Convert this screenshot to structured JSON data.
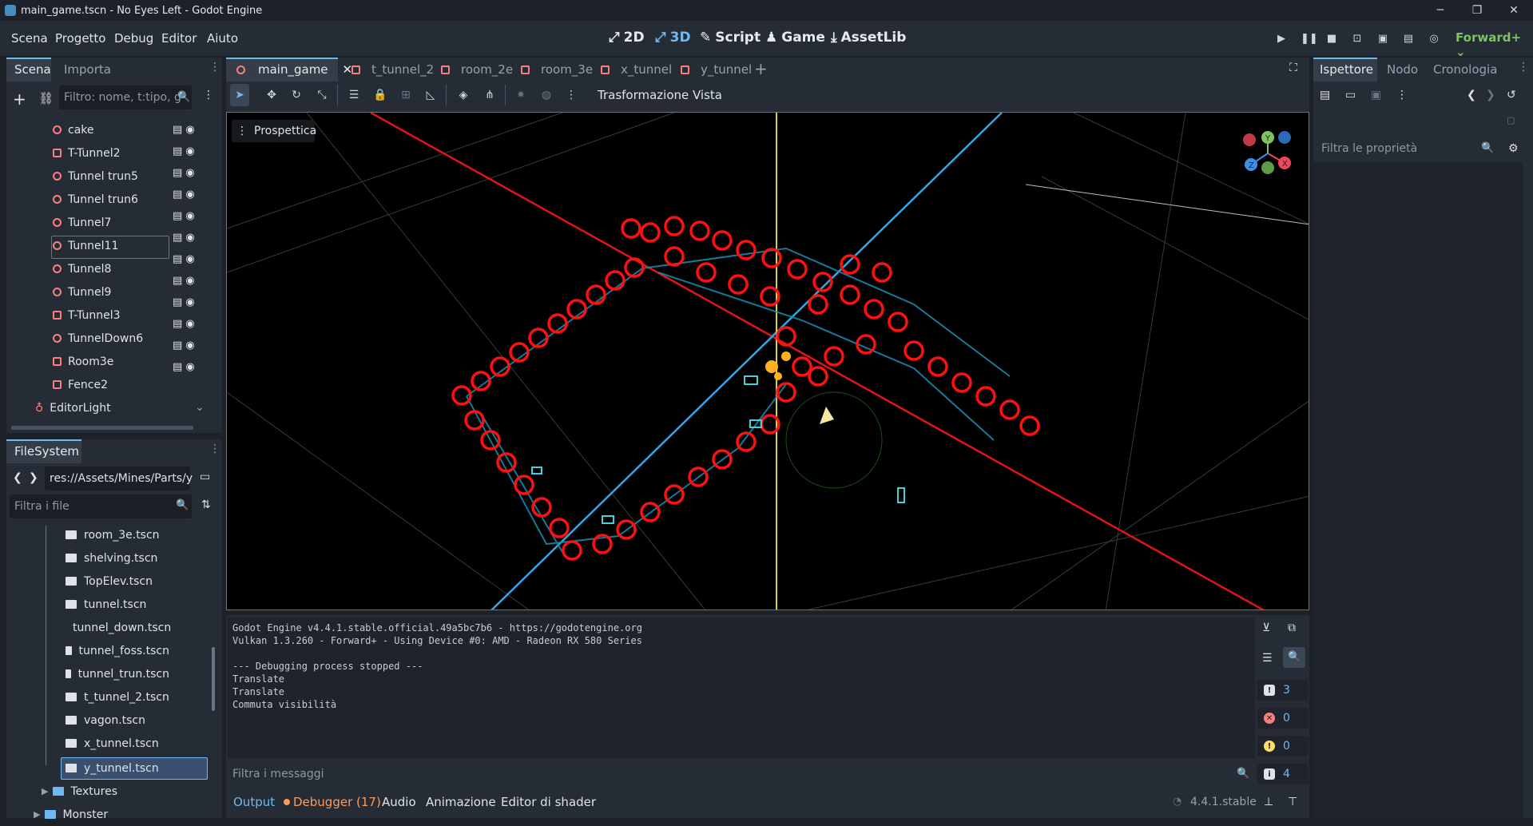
{
  "window": {
    "title": "main_game.tscn - No Eyes Left - Godot Engine"
  },
  "menu": [
    "Scena",
    "Progetto",
    "Debug",
    "Editor",
    "Aiuto"
  ],
  "modes": [
    "2D",
    "3D",
    "Script",
    "Game",
    "AssetLib"
  ],
  "renderer": "Forward+",
  "scene_dock": {
    "tabs": [
      "Scena",
      "Importa"
    ],
    "filter_placeholder": "Filtro: nome, t:tipo, g",
    "nodes": [
      "cake",
      "T-Tunnel2",
      "Tunnel trun5",
      "Tunnel trun6",
      "Tunnel7",
      "Tunnel11",
      "Tunnel8",
      "Tunnel9",
      "T-Tunnel3",
      "TunnelDown6",
      "Room3e",
      "Fence2"
    ],
    "editor_light": "EditorLight"
  },
  "filesystem": {
    "tab": "FileSystem",
    "path": "res://Assets/Mines/Parts/y",
    "filter_placeholder": "Filtra i file",
    "files": [
      "room_3e.tscn",
      "shelving.tscn",
      "TopElev.tscn",
      "tunnel.tscn",
      "tunnel_down.tscn",
      "tunnel_foss.tscn",
      "tunnel_trun.tscn",
      "t_tunnel_2.tscn",
      "vagon.tscn",
      "x_tunnel.tscn",
      "y_tunnel.tscn"
    ],
    "folders": [
      "Textures",
      "Monster"
    ]
  },
  "scene_tabs": [
    "main_game",
    "t_tunnel_2",
    "room_2e",
    "room_3e",
    "x_tunnel",
    "y_tunnel"
  ],
  "viewport_toolbar": {
    "transform": "Trasformazione",
    "view": "Vista"
  },
  "viewport": {
    "perspective": "Prospettica"
  },
  "inspector": {
    "tabs": [
      "Ispettore",
      "Nodo",
      "Cronologia"
    ],
    "filter_placeholder": "Filtra le proprietà"
  },
  "output": {
    "lines": [
      "Godot Engine v4.4.1.stable.official.49a5bc7b6 - https://godotengine.org",
      "Vulkan 1.3.260 - Forward+ - Using Device #0: AMD - Radeon RX 580 Series",
      "",
      "--- Debugging process stopped ---",
      "Translate",
      "Translate",
      "Commuta visibilità"
    ],
    "filter_placeholder": "Filtra i messaggi",
    "counts": {
      "messages": "3",
      "errors": "0",
      "warnings": "0",
      "info": "4"
    }
  },
  "bottom_tabs": [
    "Output",
    "Debugger (17)",
    "Audio",
    "Animazione",
    "Editor di shader"
  ],
  "version": "4.4.1.stable"
}
